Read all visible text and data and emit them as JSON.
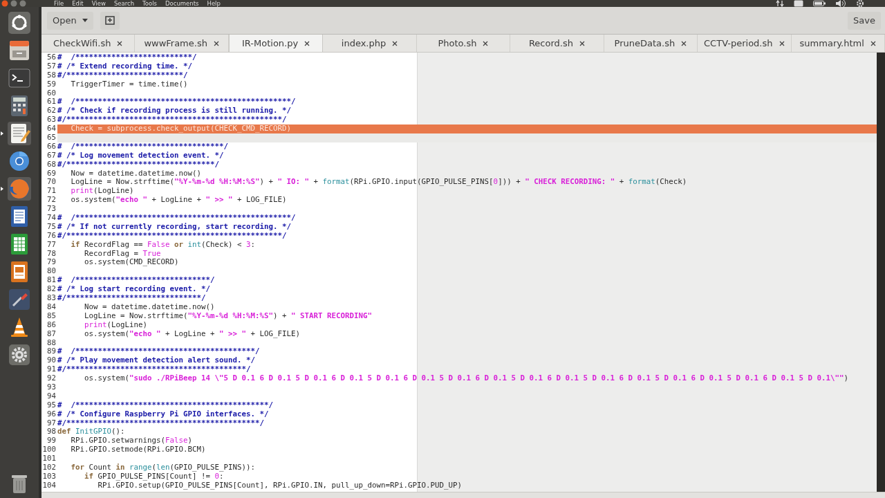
{
  "top_panel": {
    "menus": [
      "File",
      "Edit",
      "View",
      "Search",
      "Tools",
      "Documents",
      "Help"
    ]
  },
  "launcher": [
    {
      "kind": "dash",
      "running": false
    },
    {
      "kind": "files",
      "running": false
    },
    {
      "kind": "terminal",
      "running": false
    },
    {
      "kind": "calculator",
      "running": false
    },
    {
      "kind": "editor",
      "running": true
    },
    {
      "kind": "chromium",
      "running": false
    },
    {
      "kind": "firefox",
      "running": true
    },
    {
      "kind": "writer",
      "running": false
    },
    {
      "kind": "spreadsheet",
      "running": false
    },
    {
      "kind": "presentation",
      "running": false
    },
    {
      "kind": "tool",
      "running": false
    },
    {
      "kind": "vlc",
      "running": false
    },
    {
      "kind": "settings",
      "running": false
    },
    {
      "kind": "trash",
      "running": false
    }
  ],
  "toolbar": {
    "open_button": "Open",
    "save_button": "Save"
  },
  "tabs": [
    {
      "label": "CheckWifi.sh",
      "selected": false
    },
    {
      "label": "wwwFrame.sh",
      "selected": false
    },
    {
      "label": "IR-Motion.py",
      "selected": true
    },
    {
      "label": "index.php",
      "selected": false
    },
    {
      "label": "Photo.sh",
      "selected": false
    },
    {
      "label": "Record.sh",
      "selected": false
    },
    {
      "label": "PruneData.sh",
      "selected": false
    },
    {
      "label": "CCTV-period.sh",
      "selected": false
    },
    {
      "label": "summary.html",
      "selected": false
    }
  ],
  "lines": [
    {
      "number": "56",
      "tokens": [
        {
          "kind": "comment",
          "text": "#  /**************************/"
        }
      ]
    },
    {
      "number": "57",
      "tokens": [
        {
          "kind": "comment",
          "text": "# /* Extend recording time. */"
        }
      ]
    },
    {
      "number": "58",
      "tokens": [
        {
          "kind": "comment",
          "text": "#/**************************/"
        }
      ]
    },
    {
      "number": "59",
      "tokens": [
        {
          "kind": "plain",
          "text": "   TriggerTimer = time.time()"
        }
      ]
    },
    {
      "number": "60"
    },
    {
      "number": "61",
      "tokens": [
        {
          "kind": "comment",
          "text": "#  /************************************************/"
        }
      ]
    },
    {
      "number": "62",
      "tokens": [
        {
          "kind": "comment",
          "text": "# /* Check if recording process is still running. */"
        }
      ]
    },
    {
      "number": "63",
      "tokens": [
        {
          "kind": "comment",
          "text": "#/************************************************/"
        }
      ]
    },
    {
      "number": "64",
      "highlighted": true,
      "tokens": [
        {
          "kind": "plain",
          "text": "   Check = subprocess.check_output(CHECK_CMD_RECORD)"
        }
      ]
    },
    {
      "number": "65",
      "current": true
    },
    {
      "number": "66",
      "tokens": [
        {
          "kind": "comment",
          "text": "#  /*********************************/"
        }
      ]
    },
    {
      "number": "67",
      "tokens": [
        {
          "kind": "comment",
          "text": "# /* Log movement detection event. */"
        }
      ]
    },
    {
      "number": "68",
      "tokens": [
        {
          "kind": "comment",
          "text": "#/*********************************/"
        }
      ]
    },
    {
      "number": "69",
      "tokens": [
        {
          "kind": "plain",
          "text": "   Now = datetime.datetime.now()"
        }
      ]
    },
    {
      "number": "70",
      "tokens": [
        {
          "kind": "plain",
          "text": "   LogLine = Now.strftime("
        },
        {
          "kind": "string",
          "text": "\"%Y-%m-%d %H:%M:%S\""
        },
        {
          "kind": "plain",
          "text": ") + "
        },
        {
          "kind": "string",
          "text": "\" IO: \""
        },
        {
          "kind": "plain",
          "text": " + "
        },
        {
          "kind": "builtin",
          "text": "format"
        },
        {
          "kind": "plain",
          "text": "(RPi.GPIO.input(GPIO_PULSE_PINS["
        },
        {
          "kind": "constant",
          "text": "0"
        },
        {
          "kind": "plain",
          "text": "])) + "
        },
        {
          "kind": "string",
          "text": "\" CHECK RECORDING: \""
        },
        {
          "kind": "plain",
          "text": " + "
        },
        {
          "kind": "builtin",
          "text": "format"
        },
        {
          "kind": "plain",
          "text": "(Check)"
        }
      ]
    },
    {
      "number": "71",
      "tokens": [
        {
          "kind": "constant",
          "text": "   print"
        },
        {
          "kind": "plain",
          "text": "(LogLine)"
        }
      ]
    },
    {
      "number": "72",
      "tokens": [
        {
          "kind": "plain",
          "text": "   os.system("
        },
        {
          "kind": "string",
          "text": "\"echo \""
        },
        {
          "kind": "plain",
          "text": " + LogLine + "
        },
        {
          "kind": "string",
          "text": "\" >> \""
        },
        {
          "kind": "plain",
          "text": " + LOG_FILE)"
        }
      ]
    },
    {
      "number": "73"
    },
    {
      "number": "74",
      "tokens": [
        {
          "kind": "comment",
          "text": "#  /************************************************/"
        }
      ]
    },
    {
      "number": "75",
      "tokens": [
        {
          "kind": "comment",
          "text": "# /* If not currently recording, start recording. */"
        }
      ]
    },
    {
      "number": "76",
      "tokens": [
        {
          "kind": "comment",
          "text": "#/************************************************/"
        }
      ]
    },
    {
      "number": "77",
      "tokens": [
        {
          "kind": "keyword",
          "text": "   if"
        },
        {
          "kind": "plain",
          "text": " RecordFlag == "
        },
        {
          "kind": "constant",
          "text": "False"
        },
        {
          "kind": "keyword",
          "text": " or"
        },
        {
          "kind": "builtin",
          "text": " int"
        },
        {
          "kind": "plain",
          "text": "(Check) < "
        },
        {
          "kind": "constant",
          "text": "3"
        },
        {
          "kind": "plain",
          "text": ":"
        }
      ]
    },
    {
      "number": "78",
      "tokens": [
        {
          "kind": "plain",
          "text": "      RecordFlag = "
        },
        {
          "kind": "constant",
          "text": "True"
        }
      ]
    },
    {
      "number": "79",
      "tokens": [
        {
          "kind": "plain",
          "text": "      os.system(CMD_RECORD)"
        }
      ]
    },
    {
      "number": "80"
    },
    {
      "number": "81",
      "tokens": [
        {
          "kind": "comment",
          "text": "#  /******************************/"
        }
      ]
    },
    {
      "number": "82",
      "tokens": [
        {
          "kind": "comment",
          "text": "# /* Log start recording event. */"
        }
      ]
    },
    {
      "number": "83",
      "tokens": [
        {
          "kind": "comment",
          "text": "#/******************************/"
        }
      ]
    },
    {
      "number": "84",
      "tokens": [
        {
          "kind": "plain",
          "text": "      Now = datetime.datetime.now()"
        }
      ]
    },
    {
      "number": "85",
      "tokens": [
        {
          "kind": "plain",
          "text": "      LogLine = Now.strftime("
        },
        {
          "kind": "string",
          "text": "\"%Y-%m-%d %H:%M:%S\""
        },
        {
          "kind": "plain",
          "text": ") + "
        },
        {
          "kind": "string",
          "text": "\" START RECORDING\""
        }
      ]
    },
    {
      "number": "86",
      "tokens": [
        {
          "kind": "constant",
          "text": "      print"
        },
        {
          "kind": "plain",
          "text": "(LogLine)"
        }
      ]
    },
    {
      "number": "87",
      "tokens": [
        {
          "kind": "plain",
          "text": "      os.system("
        },
        {
          "kind": "string",
          "text": "\"echo \""
        },
        {
          "kind": "plain",
          "text": " + LogLine + "
        },
        {
          "kind": "string",
          "text": "\" >> \""
        },
        {
          "kind": "plain",
          "text": " + LOG_FILE)"
        }
      ]
    },
    {
      "number": "88"
    },
    {
      "number": "89",
      "tokens": [
        {
          "kind": "comment",
          "text": "#  /****************************************/"
        }
      ]
    },
    {
      "number": "90",
      "tokens": [
        {
          "kind": "comment",
          "text": "# /* Play movement detection alert sound. */"
        }
      ]
    },
    {
      "number": "91",
      "tokens": [
        {
          "kind": "comment",
          "text": "#/****************************************/"
        }
      ]
    },
    {
      "number": "92",
      "tokens": [
        {
          "kind": "plain",
          "text": "      os.system("
        },
        {
          "kind": "string",
          "text": "\"sudo ./RPiBeep 14 \\\"5 D 0.1 6 D 0.1 5 D 0.1 6 D 0.1 5 D 0.1 6 D 0.1 5 D 0.1 6 D 0.1 5 D 0.1 6 D 0.1 5 D 0.1 6 D 0.1 5 D 0.1 6 D 0.1 5 D 0.1 6 D 0.1 5 D 0.1\\\"\""
        },
        {
          "kind": "plain",
          "text": ")"
        }
      ]
    },
    {
      "number": "93"
    },
    {
      "number": "94"
    },
    {
      "number": "95",
      "tokens": [
        {
          "kind": "comment",
          "text": "#  /*******************************************/"
        }
      ]
    },
    {
      "number": "96",
      "tokens": [
        {
          "kind": "comment",
          "text": "# /* Configure Raspberry Pi GPIO interfaces. */"
        }
      ]
    },
    {
      "number": "97",
      "tokens": [
        {
          "kind": "comment",
          "text": "#/*******************************************/"
        }
      ]
    },
    {
      "number": "98",
      "tokens": [
        {
          "kind": "keyword",
          "text": "def"
        },
        {
          "kind": "function",
          "text": " InitGPIO"
        },
        {
          "kind": "plain",
          "text": "():"
        }
      ]
    },
    {
      "number": "99",
      "tokens": [
        {
          "kind": "plain",
          "text": "   RPi.GPIO.setwarnings("
        },
        {
          "kind": "constant",
          "text": "False"
        },
        {
          "kind": "plain",
          "text": ")"
        }
      ]
    },
    {
      "number": "100",
      "tokens": [
        {
          "kind": "plain",
          "text": "   RPi.GPIO.setmode(RPi.GPIO.BCM)"
        }
      ]
    },
    {
      "number": "101"
    },
    {
      "number": "102",
      "tokens": [
        {
          "kind": "keyword",
          "text": "   for"
        },
        {
          "kind": "plain",
          "text": " Count "
        },
        {
          "kind": "keyword",
          "text": "in"
        },
        {
          "kind": "builtin",
          "text": " range"
        },
        {
          "kind": "plain",
          "text": "("
        },
        {
          "kind": "builtin",
          "text": "len"
        },
        {
          "kind": "plain",
          "text": "(GPIO_PULSE_PINS)):"
        }
      ]
    },
    {
      "number": "103",
      "tokens": [
        {
          "kind": "keyword",
          "text": "      if"
        },
        {
          "kind": "plain",
          "text": " GPIO_PULSE_PINS[Count] != "
        },
        {
          "kind": "constant",
          "text": "0"
        },
        {
          "kind": "plain",
          "text": ":"
        }
      ]
    },
    {
      "number": "104",
      "tokens": [
        {
          "kind": "plain",
          "text": "         RPi.GPIO.setup(GPIO_PULSE_PINS[Count], RPi.GPIO.IN, pull_up_down=RPi.GPIO.PUD_UP)"
        }
      ]
    }
  ]
}
